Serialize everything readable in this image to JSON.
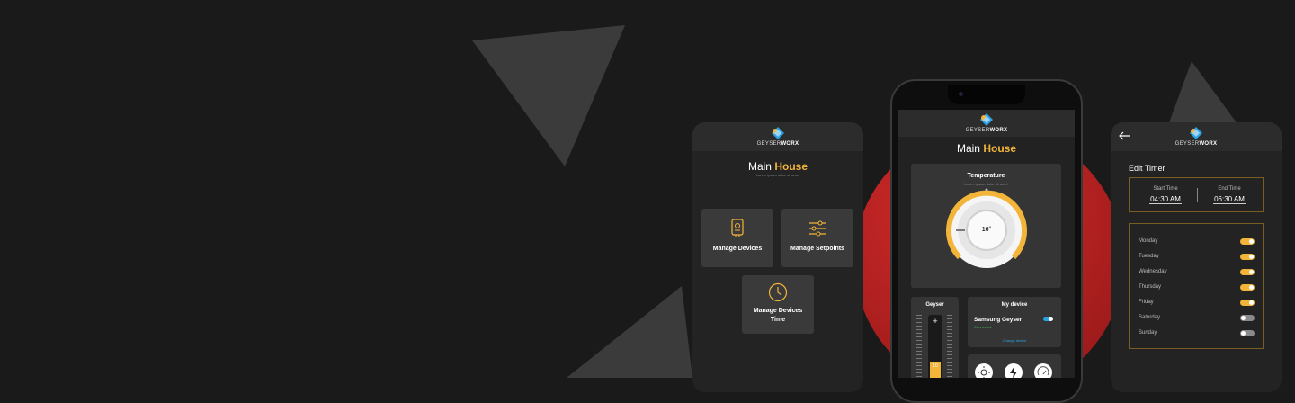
{
  "brand": {
    "logo_text_light": "GEYSER",
    "logo_text_bold": "WORX",
    "accent": "#f2b53a"
  },
  "screen_left": {
    "title_main": "Main",
    "title_accent": "House",
    "subtitle": "Lorem ipsum dolor sit amet",
    "cards": {
      "manage_devices": "Manage Devices",
      "manage_setpoints": "Manage Setpoints",
      "manage_devices_time_line1": "Manage Devices",
      "manage_devices_time_line2": "Time"
    }
  },
  "screen_center": {
    "title_main": "Main",
    "title_accent": "House",
    "temperature": {
      "label": "Temperature",
      "sub": "Lorem ipsum dolor sit amet",
      "value": "16°"
    },
    "geyser": {
      "label": "Geyser",
      "plus": "+",
      "level": "10"
    },
    "my_device": {
      "label": "My device",
      "name": "Samsung Geyser",
      "status": "Connected",
      "change": "Change device",
      "toggle_on": true
    }
  },
  "screen_right": {
    "back_icon": "arrow-left-icon",
    "heading": "Edit Timer",
    "start": {
      "label": "Start Time",
      "value": "04:30 AM"
    },
    "end": {
      "label": "End Time",
      "value": "06:30 AM"
    },
    "days": [
      {
        "name": "Monday",
        "on": true
      },
      {
        "name": "Tuesday",
        "on": true
      },
      {
        "name": "Wednesday",
        "on": true
      },
      {
        "name": "Thursday",
        "on": true
      },
      {
        "name": "Friday",
        "on": true
      },
      {
        "name": "Saturday",
        "on": false
      },
      {
        "name": "Sunday",
        "on": false
      }
    ]
  },
  "colors": {
    "toggle_on": "#f2b53a",
    "toggle_off": "#8a8a8a",
    "blue_toggle": "#29a3e8",
    "status_green": "#3fbf4f",
    "link_blue": "#29a3e8"
  }
}
